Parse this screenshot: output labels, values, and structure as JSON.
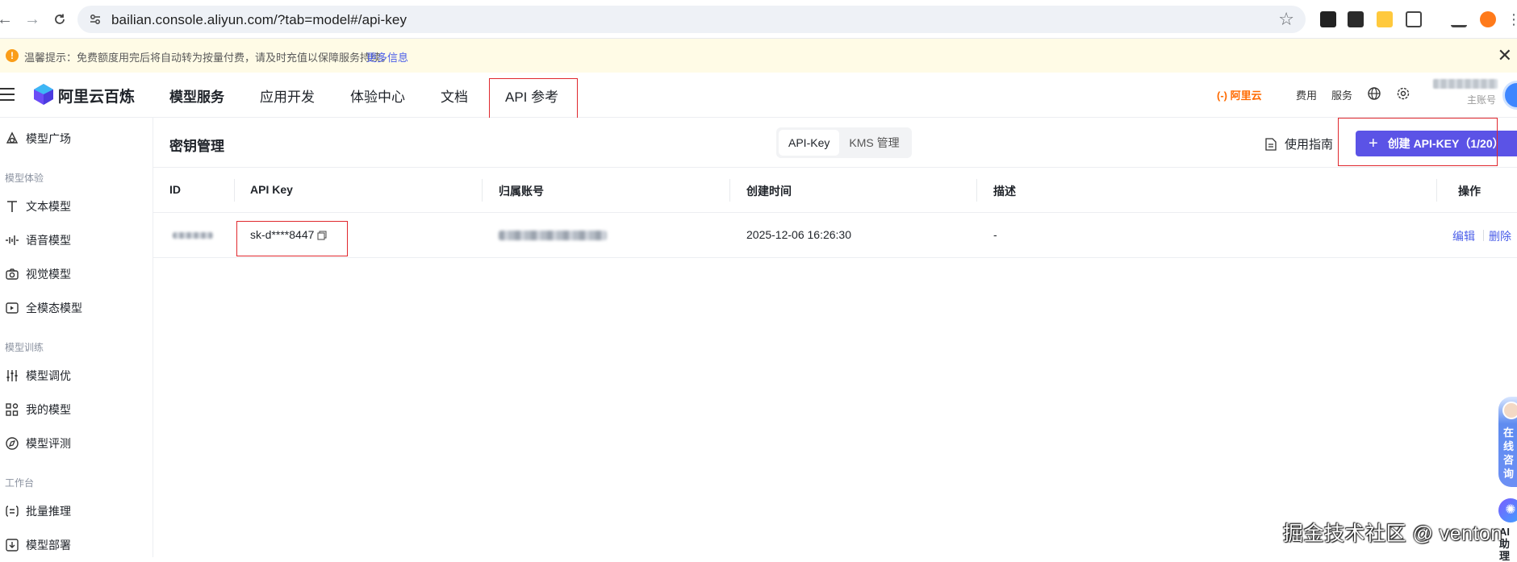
{
  "browser": {
    "url": "bailian.console.aliyun.com/?tab=model#/api-key"
  },
  "notice": {
    "text": "温馨提示：免费额度用完后将自动转为按量付费，请及时充值以保障服务持续。",
    "link": "更多信息"
  },
  "topnav": {
    "brand": "阿里云百炼",
    "items": [
      "模型服务",
      "应用开发",
      "体验中心",
      "文档",
      "API 参考"
    ],
    "aliyun": "(-) 阿里云",
    "links": [
      "费用",
      "服务"
    ],
    "account_role": "主账号"
  },
  "sidebar": {
    "items": [
      {
        "label": "模型广场"
      },
      {
        "label": "文本模型"
      },
      {
        "label": "语音模型"
      },
      {
        "label": "视觉模型"
      },
      {
        "label": "全模态模型"
      },
      {
        "label": "模型调优"
      },
      {
        "label": "我的模型"
      },
      {
        "label": "模型评测"
      },
      {
        "label": "批量推理"
      },
      {
        "label": "模型部署"
      }
    ],
    "groups": [
      "模型体验",
      "模型训练",
      "工作台"
    ]
  },
  "page": {
    "title": "密钥管理",
    "segments": [
      "API-Key",
      "KMS 管理"
    ],
    "guide": "使用指南",
    "create_button": "创建 API-KEY（1/20）"
  },
  "table": {
    "headers": [
      "ID",
      "API Key",
      "归属账号",
      "创建时间",
      "描述",
      "操作"
    ],
    "rows": [
      {
        "api_key": "sk-d****8447",
        "created": "2025-12-06 16:26:30",
        "desc": "-",
        "edit": "编辑",
        "delete": "删除"
      }
    ]
  },
  "floating": {
    "consult": "在线咨询",
    "ai": "AI 助理"
  },
  "watermark": "掘金技术社区 @ venton"
}
